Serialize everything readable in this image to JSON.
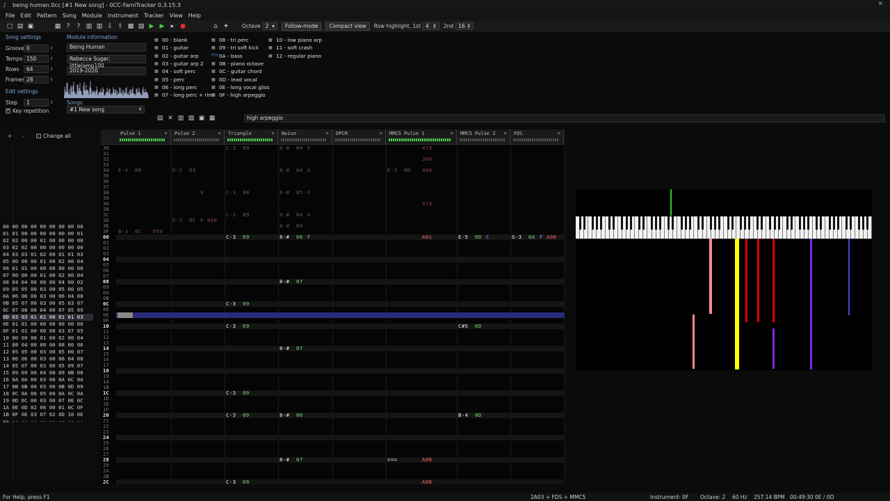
{
  "window": {
    "title": "being human.0cc [#1 New song] - 0CC-FamiTracker 0.3.15.3",
    "close_glyph": "✕"
  },
  "menu": [
    "File",
    "Edit",
    "Pattern",
    "Song",
    "Module",
    "Instrument",
    "Tracker",
    "View",
    "Help"
  ],
  "toolbar": {
    "octave_label": "Octave",
    "octave_value": "2",
    "follow_mode": "Follow-mode",
    "compact_view": "Compact view",
    "row_highlight_label": "Row highlight, 1st",
    "row_highlight_1st": "4",
    "second_label": "2nd",
    "row_highlight_2nd": "16"
  },
  "song_settings": {
    "header": "Song settings",
    "groove_label": "Groove",
    "groove": "0",
    "tempo_label": "Tempo",
    "tempo": "150",
    "rows_label": "Rows",
    "rows": "64",
    "frames_label": "Frames",
    "frames": "28",
    "edit_header": "Edit settings",
    "step_label": "Step",
    "step": "1",
    "key_repetition": "Key repetition"
  },
  "module_info": {
    "header": "Module information",
    "title": "Being Human",
    "author": "Rebecca Sugar; littlelamp100",
    "copyright": "2019-2020",
    "songs_label": "Songs",
    "song_selected": "#1 New song"
  },
  "instruments": [
    {
      "label": "00 - blank",
      "type": "2a03"
    },
    {
      "label": "01 - guitar",
      "type": "2a03"
    },
    {
      "label": "02 - guitar arp",
      "type": "2a03"
    },
    {
      "label": "03 - guitar arp 2",
      "type": "2a03"
    },
    {
      "label": "04 - soft perc",
      "type": "2a03"
    },
    {
      "label": "05 - perc",
      "type": "2a03"
    },
    {
      "label": "06 - long perc",
      "type": "2a03"
    },
    {
      "label": "07 - long perc + rim",
      "type": "2a03"
    },
    {
      "label": "08 - tri perc",
      "type": "2a03"
    },
    {
      "label": "09 - tri soft kick",
      "type": "2a03"
    },
    {
      "label": "0A - bass",
      "type": "fds"
    },
    {
      "label": "0B - piano octave",
      "type": "2a03"
    },
    {
      "label": "0C - guitar chord",
      "type": "2a03"
    },
    {
      "label": "0D - lead vocal",
      "type": "2a03"
    },
    {
      "label": "0E - long vocal gliss",
      "type": "2a03"
    },
    {
      "label": "0F - high arpeggio",
      "type": "2a03"
    },
    {
      "label": "10 - low piano arp",
      "type": "2a03"
    },
    {
      "label": "11 - soft crash",
      "type": "2a03"
    },
    {
      "label": "12 - regular piano",
      "type": "2a03"
    }
  ],
  "instrument_name": "high arpeggio",
  "frame_panel": {
    "change_all": "Change all",
    "rows": [
      "00 00 00 00 00 00 00 00 00",
      "01 01 00 00 00 00 00 00 01",
      "02 02 00 00 01 00 00 00 00",
      "03 02 02 00 00 00 00 00 00",
      "04 03 03 01 02 00 01 01 03",
      "05 00 00 00 01 00 02 00 04",
      "06 01 01 00 00 00 00 00 00",
      "07 00 00 00 01 00 02 00 04",
      "08 04 04 00 00 00 04 00 02",
      "09 05 05 00 03 00 05 00 05",
      "0A 06 06 00 03 00 06 04 08",
      "0B 05 07 00 03 00 05 03 07",
      "0C 07 08 00 04 00 07 05 09",
      "0D 03 03 01 02 00 01 01 03",
      "0E 01 01 00 00 00 00 00 00",
      "0F 01 01 00 00 00 03 07 05",
      "10 00 00 00 01 00 02 00 04",
      "11 08 04 00 00 00 08 00 06",
      "12 05 05 00 03 00 05 00 07",
      "13 06 06 00 03 00 06 04 08",
      "14 05 07 00 03 00 05 09 07",
      "15 09 09 00 04 00 09 0B 08",
      "16 0A 0A 00 03 00 0A 0C 0A",
      "17 0B 0B 00 03 00 0B 0D 09",
      "18 0C 0A 00 05 00 0A 0C 0A",
      "19 0D 0C 00 03 00 07 0E 0C",
      "1A 0E 0D 02 06 00 01 0C 0F",
      "1B 0F 0E 03 07 02 0D 10 0E",
      ">> -- -- -- -- -- -- -- --"
    ],
    "current_index": 13
  },
  "channels": [
    {
      "name": "Pulse 1",
      "active": true
    },
    {
      "name": "Pulse 2",
      "active": false
    },
    {
      "name": "Triangle",
      "active": true
    },
    {
      "name": "Noise",
      "active": false
    },
    {
      "name": "DPCM",
      "active": false
    },
    {
      "name": "MMC5 Pulse 1",
      "active": true
    },
    {
      "name": "MMC5 Pulse 2",
      "active": false
    },
    {
      "name": "FDS",
      "active": false
    }
  ],
  "pattern": {
    "prev_rows": [
      "30",
      "31",
      "32",
      "33",
      "34",
      "35",
      "36",
      "37",
      "38",
      "39",
      "3A",
      "3B",
      "3C",
      "3D",
      "3E",
      "3F"
    ],
    "rows": [
      "00",
      "01",
      "02",
      "03",
      "04",
      "05",
      "06",
      "07",
      "08",
      "09",
      "0A",
      "0B",
      "0C",
      "0D",
      "0E",
      "0F",
      "10",
      "11",
      "12",
      "13",
      "14",
      "15",
      "16",
      "17",
      "18",
      "19",
      "1A",
      "1B",
      "1C",
      "1D",
      "1E",
      "1F",
      "20",
      "21",
      "22",
      "23",
      "24",
      "25",
      "26",
      "27",
      "28",
      "29",
      "2A",
      "2B",
      "2C"
    ],
    "cursor_row": "0E",
    "cells": [
      {
        "row": "30",
        "ch": 2,
        "dim": true,
        "n": "C-3",
        "i": "09",
        "v": "",
        "e": ""
      },
      {
        "row": "30",
        "ch": 3,
        "dim": true,
        "n": "8-#",
        "i": "04",
        "v": "F",
        "e": ""
      },
      {
        "row": "30",
        "ch": 5,
        "dim": true,
        "n": "",
        "i": "",
        "v": "",
        "e": "473"
      },
      {
        "row": "32",
        "ch": 5,
        "dim": true,
        "n": "",
        "i": "",
        "v": "",
        "e": "300"
      },
      {
        "row": "34",
        "ch": 0,
        "dim": true,
        "n": "E-4",
        "i": "00",
        "v": "",
        "e": ""
      },
      {
        "row": "34",
        "ch": 1,
        "dim": true,
        "n": "D-2",
        "i": "03",
        "v": "",
        "e": ""
      },
      {
        "row": "34",
        "ch": 3,
        "dim": true,
        "n": "8-#",
        "i": "04",
        "v": "A",
        "e": ""
      },
      {
        "row": "34",
        "ch": 5,
        "dim": true,
        "n": "E-3",
        "i": "0D",
        "v": "",
        "e": "400"
      },
      {
        "row": "38",
        "ch": 1,
        "dim": true,
        "n": "",
        "i": "",
        "v": "8",
        "e": ""
      },
      {
        "row": "38",
        "ch": 2,
        "dim": true,
        "n": "C-3",
        "i": "08",
        "v": "",
        "e": ""
      },
      {
        "row": "38",
        "ch": 3,
        "dim": true,
        "n": "8-#",
        "i": "05",
        "v": "F",
        "e": ""
      },
      {
        "row": "3A",
        "ch": 5,
        "dim": true,
        "n": "",
        "i": "",
        "v": "",
        "e": "473"
      },
      {
        "row": "3C",
        "ch": 2,
        "dim": true,
        "n": "C-3",
        "i": "09",
        "v": "",
        "e": ""
      },
      {
        "row": "3C",
        "ch": 3,
        "dim": true,
        "n": "8-#",
        "i": "04",
        "v": "A",
        "e": ""
      },
      {
        "row": "3D",
        "ch": 1,
        "dim": true,
        "n": "D-3",
        "i": "0C",
        "v": "F",
        "e": "048"
      },
      {
        "row": "3E",
        "ch": 3,
        "dim": true,
        "n": "8-#",
        "i": "04",
        "v": "",
        "e": ""
      },
      {
        "row": "3F",
        "ch": 0,
        "dim": true,
        "n": "B-3",
        "i": "0C",
        "v": "",
        "e": "050"
      },
      {
        "row": "00",
        "ch": 2,
        "dim": false,
        "n": "C-3",
        "i": "09",
        "v": "",
        "e": ""
      },
      {
        "row": "00",
        "ch": 3,
        "dim": false,
        "n": "8-#",
        "i": "06",
        "v": "F",
        "e": ""
      },
      {
        "row": "00",
        "ch": 5,
        "dim": false,
        "n": "",
        "i": "",
        "v": "",
        "e": "A01"
      },
      {
        "row": "00",
        "ch": 6,
        "dim": false,
        "n": "E-5",
        "i": "0D",
        "v": "C",
        "e": ""
      },
      {
        "row": "00",
        "ch": 7,
        "dim": false,
        "n": "G-3",
        "i": "0A",
        "v": "F",
        "e": "A00"
      },
      {
        "row": "08",
        "ch": 3,
        "dim": false,
        "n": "8-#",
        "i": "07",
        "v": "",
        "e": ""
      },
      {
        "row": "0C",
        "ch": 2,
        "dim": false,
        "n": "C-3",
        "i": "09",
        "v": "",
        "e": ""
      },
      {
        "row": "10",
        "ch": 2,
        "dim": false,
        "n": "C-3",
        "i": "09",
        "v": "",
        "e": ""
      },
      {
        "row": "10",
        "ch": 6,
        "dim": false,
        "n": "C#5",
        "i": "0D",
        "v": "",
        "e": ""
      },
      {
        "row": "14",
        "ch": 3,
        "dim": false,
        "n": "8-#",
        "i": "07",
        "v": "",
        "e": ""
      },
      {
        "row": "1C",
        "ch": 2,
        "dim": false,
        "n": "C-3",
        "i": "09",
        "v": "",
        "e": ""
      },
      {
        "row": "20",
        "ch": 2,
        "dim": false,
        "n": "C-3",
        "i": "09",
        "v": "",
        "e": ""
      },
      {
        "row": "20",
        "ch": 3,
        "dim": false,
        "n": "8-#",
        "i": "06",
        "v": "",
        "e": ""
      },
      {
        "row": "20",
        "ch": 6,
        "dim": false,
        "n": "B-4",
        "i": "0D",
        "v": "",
        "e": ""
      },
      {
        "row": "28",
        "ch": 3,
        "dim": false,
        "n": "8-#",
        "i": "07",
        "v": "",
        "e": ""
      },
      {
        "row": "28",
        "ch": 5,
        "dim": false,
        "n": "===",
        "i": "",
        "v": "",
        "e": "A00"
      },
      {
        "row": "2C",
        "ch": 2,
        "dim": false,
        "n": "C-3",
        "i": "09",
        "v": "",
        "e": ""
      },
      {
        "row": "2C",
        "ch": 5,
        "dim": false,
        "n": "",
        "i": "",
        "v": "",
        "e": "A00"
      }
    ]
  },
  "status": {
    "help": "For Help, press F1",
    "chips": "2A03 + FDS + MMC5",
    "instrument": "Instrument: 0F",
    "octave": "Octave: 2",
    "rate": "60 Hz",
    "bpm": "257.14 BPM",
    "time": "00:49:30",
    "position": "0E / 0D"
  },
  "colors": {
    "cursor_row": "#2a2a7a",
    "note": "#f0f0f0",
    "instrument": "#7fe07f",
    "volume": "#8ea6ff",
    "effect": "#ff6b6b",
    "active_meter": "#4dd24d"
  }
}
